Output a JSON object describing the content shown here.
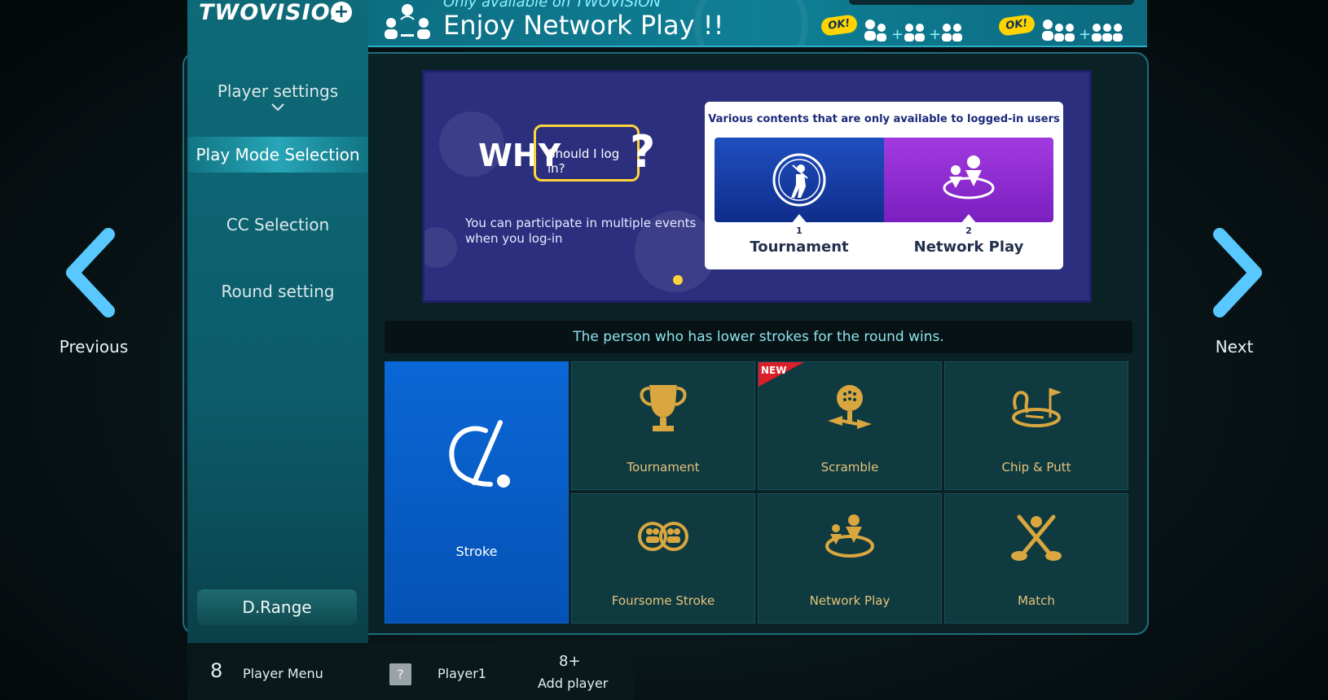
{
  "brand": {
    "logo": "TWOVISION",
    "logo_mark": "+"
  },
  "banner": {
    "subtitle": "Only available on TWOVISION",
    "title": "Enjoy Network Play !!",
    "ok1": "OK!",
    "ok2": "OK!"
  },
  "nav": {
    "previous": "Previous",
    "next": "Next"
  },
  "sidebar": {
    "items": [
      {
        "label": "Player settings"
      },
      {
        "label": "Play Mode Selection"
      },
      {
        "label": "CC Selection"
      },
      {
        "label": "Round setting"
      }
    ],
    "drange": "D.Range"
  },
  "promo": {
    "why": "WHY",
    "why_box": "Should I log in?",
    "why_q": "?",
    "text_line1": "You can participate in multiple events",
    "text_line2": "when you log-in",
    "card_title": "Various contents that are only available to logged-in users",
    "cards": [
      {
        "num": "1",
        "label": "Tournament"
      },
      {
        "num": "2",
        "label": "Network Play"
      }
    ]
  },
  "description": "The person who has lower strokes for the round wins.",
  "modes": [
    {
      "label": "Stroke",
      "selected": true
    },
    {
      "label": "Tournament"
    },
    {
      "label": "Scramble",
      "badge": "NEW"
    },
    {
      "label": "Chip & Putt"
    },
    {
      "label": "Foursome Stroke"
    },
    {
      "label": "Network Play"
    },
    {
      "label": "Match"
    }
  ],
  "bottom": {
    "player_menu_icon": "8",
    "player_menu": "Player Menu",
    "player_icon": "?",
    "player1": "Player1",
    "add_icon": "8+",
    "add_player": "Add player"
  },
  "colors": {
    "accent": "#0a67d6",
    "gold": "#e7c37a",
    "promo_bg": "#2c2f7e"
  }
}
